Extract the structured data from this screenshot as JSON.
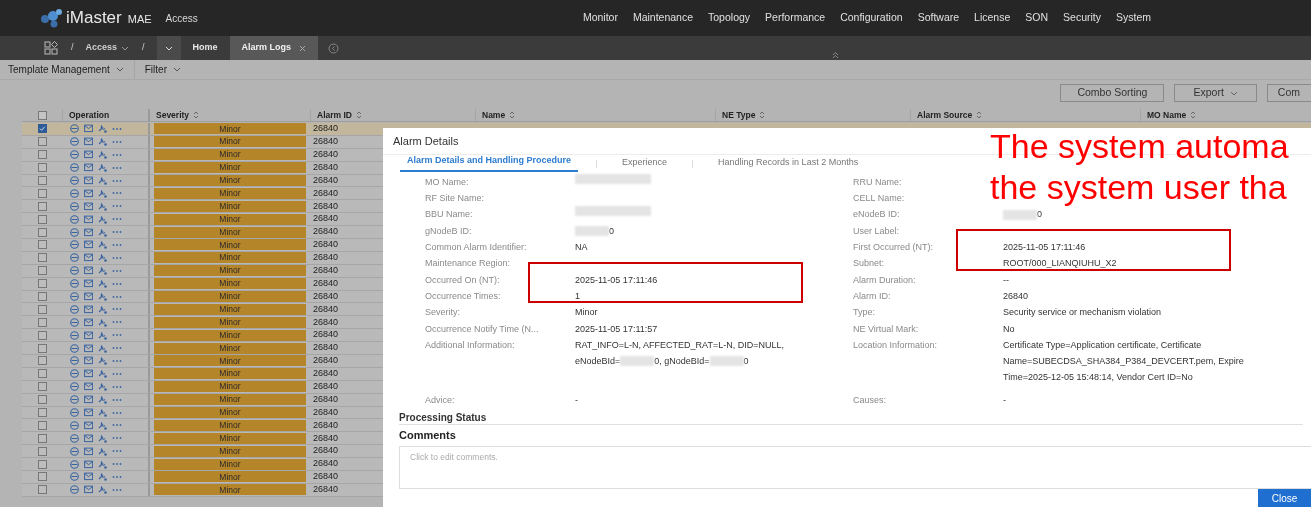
{
  "app": {
    "brand": "iMaster",
    "brand_suffix": "MAE",
    "section": "Access"
  },
  "nav": [
    "Monitor",
    "Maintenance",
    "Topology",
    "Performance",
    "Configuration",
    "Software",
    "License",
    "SON",
    "Security",
    "System"
  ],
  "breadcrumb": [
    {
      "kind": "separator",
      "text": "/"
    },
    {
      "kind": "menu",
      "text": "Access"
    },
    {
      "kind": "separator",
      "text": "/"
    }
  ],
  "tabs": [
    {
      "label": "Home",
      "selected": false
    },
    {
      "label": "Alarm Logs",
      "selected": true,
      "closable": true
    }
  ],
  "toolbar": {
    "menus": [
      "Template Management",
      "Filter"
    ],
    "buttons": [
      {
        "label": "Combo Sorting",
        "kind": "plain"
      },
      {
        "label": "Export",
        "kind": "menu"
      },
      {
        "label": "Com",
        "kind": "plain"
      }
    ]
  },
  "table": {
    "header_checked": false,
    "columns": [
      "Operation",
      "Severity",
      "Alarm ID",
      "Name",
      "NE Type",
      "Alarm Source",
      "MO Name"
    ],
    "rows": [
      {
        "checked": true,
        "severity": "Minor",
        "alarm_id": "26840"
      },
      {
        "checked": false,
        "severity": "Minor",
        "alarm_id": "26840"
      },
      {
        "checked": false,
        "severity": "Minor",
        "alarm_id": "26840"
      },
      {
        "checked": false,
        "severity": "Minor",
        "alarm_id": "26840"
      },
      {
        "checked": false,
        "severity": "Minor",
        "alarm_id": "26840"
      },
      {
        "checked": false,
        "severity": "Minor",
        "alarm_id": "26840"
      },
      {
        "checked": false,
        "severity": "Minor",
        "alarm_id": "26840"
      },
      {
        "checked": false,
        "severity": "Minor",
        "alarm_id": "26840"
      },
      {
        "checked": false,
        "severity": "Minor",
        "alarm_id": "26840"
      },
      {
        "checked": false,
        "severity": "Minor",
        "alarm_id": "26840"
      },
      {
        "checked": false,
        "severity": "Minor",
        "alarm_id": "26840"
      },
      {
        "checked": false,
        "severity": "Minor",
        "alarm_id": "26840"
      },
      {
        "checked": false,
        "severity": "Minor",
        "alarm_id": "26840"
      },
      {
        "checked": false,
        "severity": "Minor",
        "alarm_id": "26840"
      },
      {
        "checked": false,
        "severity": "Minor",
        "alarm_id": "26840"
      },
      {
        "checked": false,
        "severity": "Minor",
        "alarm_id": "26840"
      },
      {
        "checked": false,
        "severity": "Minor",
        "alarm_id": "26840"
      },
      {
        "checked": false,
        "severity": "Minor",
        "alarm_id": "26840"
      },
      {
        "checked": false,
        "severity": "Minor",
        "alarm_id": "26840"
      },
      {
        "checked": false,
        "severity": "Minor",
        "alarm_id": "26840"
      },
      {
        "checked": false,
        "severity": "Minor",
        "alarm_id": "26840"
      },
      {
        "checked": false,
        "severity": "Minor",
        "alarm_id": "26840"
      },
      {
        "checked": false,
        "severity": "Minor",
        "alarm_id": "26840"
      },
      {
        "checked": false,
        "severity": "Minor",
        "alarm_id": "26840"
      },
      {
        "checked": false,
        "severity": "Minor",
        "alarm_id": "26840"
      },
      {
        "checked": false,
        "severity": "Minor",
        "alarm_id": "26840"
      },
      {
        "checked": false,
        "severity": "Minor",
        "alarm_id": "26840"
      },
      {
        "checked": false,
        "severity": "Minor",
        "alarm_id": "26840"
      },
      {
        "checked": false,
        "severity": "Minor",
        "alarm_id": "26840"
      }
    ]
  },
  "dialog": {
    "title": "Alarm Details",
    "tabs": [
      {
        "label": "Alarm Details and Handling Procedure",
        "selected": true
      },
      {
        "label": "Experience",
        "selected": false
      },
      {
        "label": "Handling Records in Last 2 Months",
        "selected": false
      }
    ],
    "left_fields": [
      {
        "label": "MO Name:",
        "parts": [
          {
            "kind": "blur_long"
          }
        ]
      },
      {
        "label": "RF Site Name:"
      },
      {
        "label": "BBU Name:",
        "parts": [
          {
            "kind": "blur_long"
          }
        ]
      },
      {
        "label": "gNodeB ID:",
        "parts": [
          {
            "kind": "blur_short"
          },
          {
            "kind": "text",
            "text": "0"
          }
        ]
      },
      {
        "label": "Common Alarm Identifier:",
        "value": "NA"
      },
      {
        "label": "Maintenance Region:"
      },
      {
        "label": "Occurred On (NT):",
        "value": "2025-11-05 17:11:46",
        "highlighted": true
      },
      {
        "label": "Occurrence Times:",
        "value": "1",
        "highlighted": true
      },
      {
        "label": "Severity:",
        "value": "Minor"
      },
      {
        "label": "Occurrence Notify Time (N...",
        "value": "2025-11-05 17:11:57"
      },
      {
        "label": "Additional Information:",
        "parts": [
          {
            "kind": "text",
            "text": "RAT_INFO=L-N, AFFECTED_RAT=L-N, DID=NULL,"
          },
          {
            "kind": "break"
          },
          {
            "kind": "text",
            "text": "eNodeBId="
          },
          {
            "kind": "blur_short"
          },
          {
            "kind": "text",
            "text": "0, gNodeBId="
          },
          {
            "kind": "blur_short"
          },
          {
            "kind": "text",
            "text": "0"
          }
        ]
      },
      {
        "label": "Advice:",
        "value": "-"
      }
    ],
    "right_fields": [
      {
        "label": "RRU Name:"
      },
      {
        "label": "CELL Name:"
      },
      {
        "label": "eNodeB ID:",
        "parts": [
          {
            "kind": "blur_short"
          },
          {
            "kind": "text",
            "text": "0"
          }
        ]
      },
      {
        "label": "User Label:"
      },
      {
        "label": "First Occurred (NT):",
        "value": "2025-11-05 17:11:46",
        "highlighted": true
      },
      {
        "label": "Subnet:",
        "value": "ROOT/000_LIANQIUHU_X2",
        "highlighted": true
      },
      {
        "label": "Alarm Duration:",
        "value": "--"
      },
      {
        "label": "Alarm ID:",
        "value": "26840"
      },
      {
        "label": "Type:",
        "value": "Security service or mechanism violation"
      },
      {
        "label": "NE Virtual Mark:",
        "value": "No"
      },
      {
        "label": "Location Information:",
        "parts": [
          {
            "kind": "text",
            "text": "Certificate Type=Application certificate, Certificate"
          },
          {
            "kind": "break"
          },
          {
            "kind": "text",
            "text": "Name=SUBECDSA_SHA384_P384_DEVCERT.pem, Expire"
          },
          {
            "kind": "break"
          },
          {
            "kind": "text",
            "text": "Time=2025-12-05 15:48:14, Vendor Cert ID=No"
          }
        ]
      },
      {
        "label": "Causes:",
        "value": "-"
      }
    ],
    "section_heading": "Processing Status",
    "comments": {
      "title": "Comments",
      "placeholder": "Click to edit comments."
    },
    "close_button": "Close"
  },
  "annotation": {
    "lines": [
      "The system automa",
      "the system user tha"
    ]
  }
}
